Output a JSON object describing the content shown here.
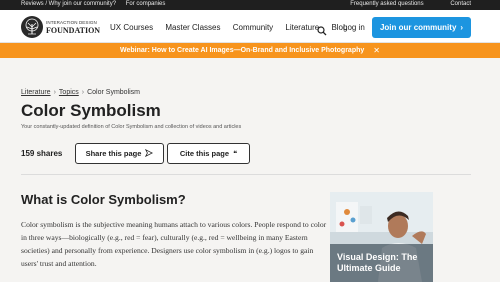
{
  "topbar": {
    "left_links": [
      "Reviews / Why join our community?",
      "For companies"
    ],
    "right_links": [
      "Frequently asked questions",
      "Contact"
    ]
  },
  "header": {
    "logo_line1": "INTERACTION DESIGN",
    "logo_line2": "FOUNDATION",
    "nav": [
      "UX Courses",
      "Master Classes",
      "Community",
      "Literature",
      "Blog"
    ],
    "login_label": "Log in",
    "join_label": "Join our community"
  },
  "banner": {
    "text": "Webinar: How to Create AI Images—On-Brand and Inclusive Photography",
    "close": "✕"
  },
  "breadcrumb": [
    "Literature",
    "Topics",
    "Color Symbolism"
  ],
  "page": {
    "title": "Color Symbolism",
    "subtitle": "Your constantly-updated definition of Color Symbolism and collection of videos and articles",
    "shares": "159 shares",
    "share_button": "Share this page",
    "cite_button": "Cite this page"
  },
  "article": {
    "heading": "What is Color Symbolism?",
    "paragraph": "Color symbolism is the subjective meaning humans attach to various colors. People respond to color in three ways—biologically (e.g., red = fear), culturally (e.g., red = wellbeing in many Eastern societies) and personally from experience. Designers use color symbolism in (e.g.) logos to gain users' trust and attention."
  },
  "card": {
    "title": "Visual Design: The Ultimate Guide"
  },
  "colors": {
    "accent_blue": "#1c95e0",
    "banner_orange": "#f7941d",
    "topbar_dark": "#1f1f1f"
  }
}
